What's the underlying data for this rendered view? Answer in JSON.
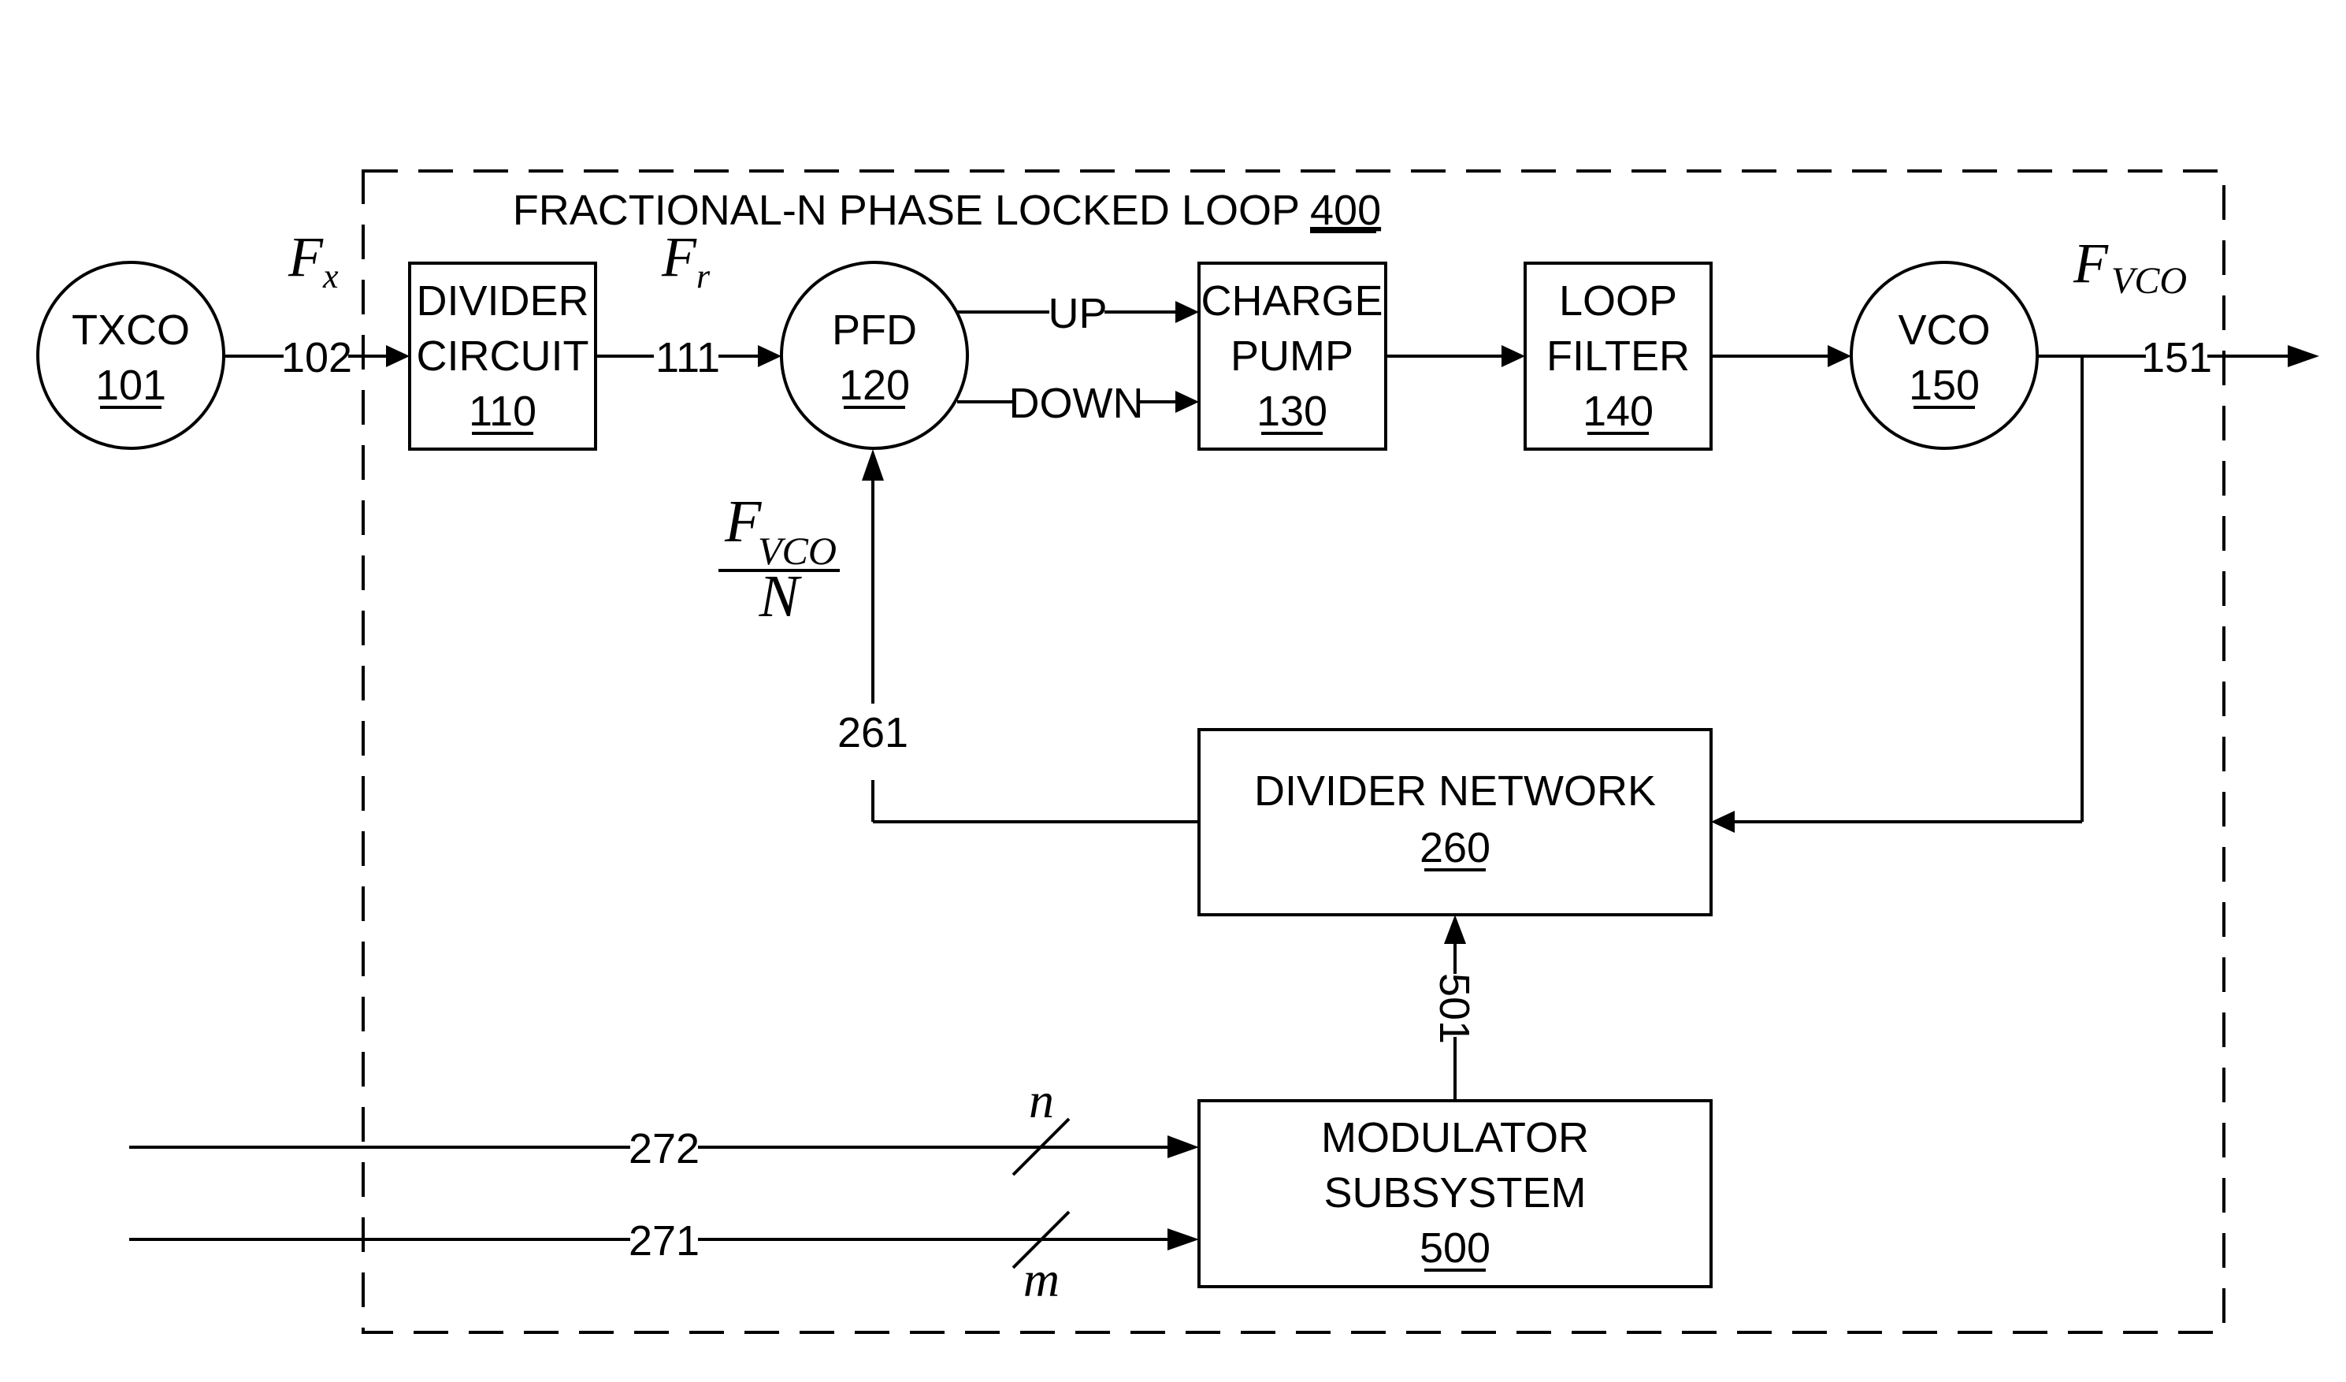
{
  "diagram": {
    "title": "FRACTIONAL-N PHASE LOCKED LOOP",
    "title_ref": "400",
    "colors": {
      "line": "#000000",
      "background": "#ffffff"
    },
    "blocks": {
      "txco": {
        "line1": "TXCO",
        "ref": "101"
      },
      "divider_circuit": {
        "line1": "DIVIDER",
        "line2": "CIRCUIT",
        "ref": "110"
      },
      "pfd": {
        "line1": "PFD",
        "ref": "120"
      },
      "charge_pump": {
        "line1": "CHARGE",
        "line2": "PUMP",
        "ref": "130"
      },
      "loop_filter": {
        "line1": "LOOP",
        "line2": "FILTER",
        "ref": "140"
      },
      "vco": {
        "line1": "VCO",
        "ref": "150"
      },
      "divider_network": {
        "line1": "DIVIDER NETWORK",
        "ref": "260"
      },
      "modulator": {
        "line1": "MODULATOR",
        "line2": "SUBSYSTEM",
        "ref": "500"
      }
    },
    "signals": {
      "s102": "102",
      "s111": "111",
      "s151": "151",
      "s261": "261",
      "s501": "501",
      "s272": "272",
      "s271": "271",
      "up": "UP",
      "down": "DOWN"
    },
    "math": {
      "fx_main": "F",
      "fx_sub": "x",
      "fr_main": "F",
      "fr_sub": "r",
      "fvco_main": "F",
      "fvco_sub": "VCO",
      "frac_num_main": "F",
      "frac_num_sub": "VCO",
      "frac_den": "N",
      "bus_n": "n",
      "bus_m": "m"
    }
  }
}
